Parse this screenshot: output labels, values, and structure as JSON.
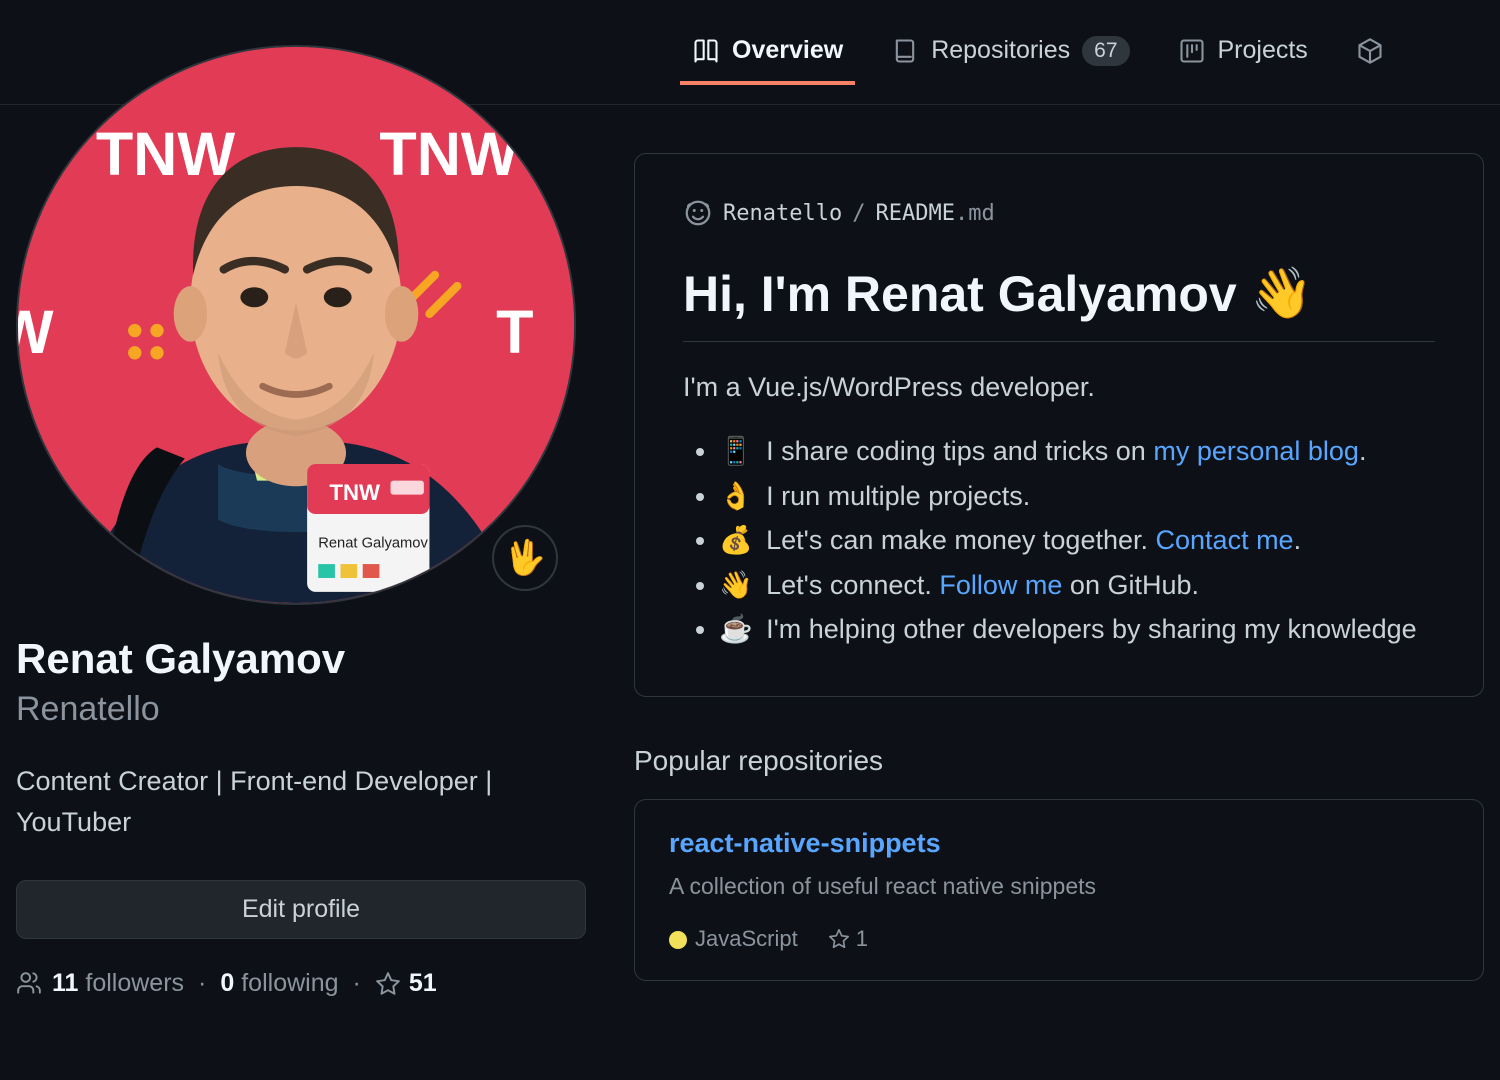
{
  "tabs": {
    "overview": "Overview",
    "repositories": "Repositories",
    "repositories_count": "67",
    "projects": "Projects"
  },
  "profile": {
    "status_emoji": "🖖",
    "fullname": "Renat Galyamov",
    "username": "Renatello",
    "bio": "Content Creator | Front-end Developer | YouTuber",
    "edit_label": "Edit profile",
    "followers_count": "11",
    "followers_label": "followers",
    "following_count": "0",
    "following_label": "following",
    "stars_count": "51"
  },
  "readme": {
    "path_user": "Renatello",
    "path_sep": "/",
    "path_file": "README",
    "path_ext": ".md",
    "heading": "Hi, I'm Renat Galyamov",
    "heading_emoji": "👋",
    "intro": "I'm a Vue.js/WordPress developer.",
    "items": [
      {
        "emoji": "📱",
        "pre": "I share coding tips and tricks on ",
        "link": "my personal blog",
        "post": "."
      },
      {
        "emoji": "👌",
        "pre": "I run multiple projects.",
        "link": "",
        "post": ""
      },
      {
        "emoji": "💰",
        "pre": "Let's can make money together. ",
        "link": "Contact me",
        "post": "."
      },
      {
        "emoji": "👋",
        "pre": "Let's connect. ",
        "link": "Follow me",
        "post": " on GitHub."
      },
      {
        "emoji": "☕",
        "pre": "I'm helping other developers by sharing my knowledge",
        "link": "",
        "post": ""
      }
    ]
  },
  "popular": {
    "heading": "Popular repositories",
    "repo": {
      "name": "react-native-snippets",
      "desc": "A collection of useful react native snippets",
      "lang": "JavaScript",
      "lang_color": "#f1e05a",
      "stars": "1"
    }
  }
}
